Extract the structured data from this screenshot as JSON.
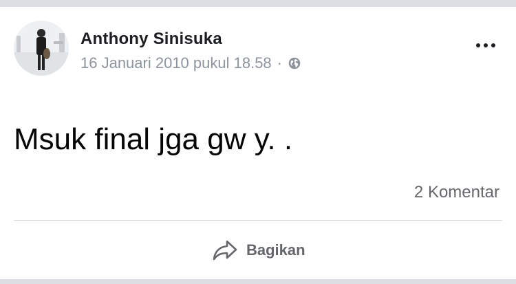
{
  "post": {
    "author": "Anthony Sinisuka",
    "timestamp": "16 Januari 2010 pukul 18.58",
    "separator": "·",
    "privacy_icon": "globe-icon",
    "text": "Msuk final jga gw y. .",
    "comments_label": "2 Komentar",
    "more_icon": "more-options-icon"
  },
  "actions": {
    "share_label": "Bagikan",
    "share_icon": "share-arrow-icon"
  },
  "colors": {
    "text_primary": "#1c1e21",
    "text_secondary": "#65676b",
    "meta_gray": "#8d949e",
    "divider": "#dadde1"
  }
}
